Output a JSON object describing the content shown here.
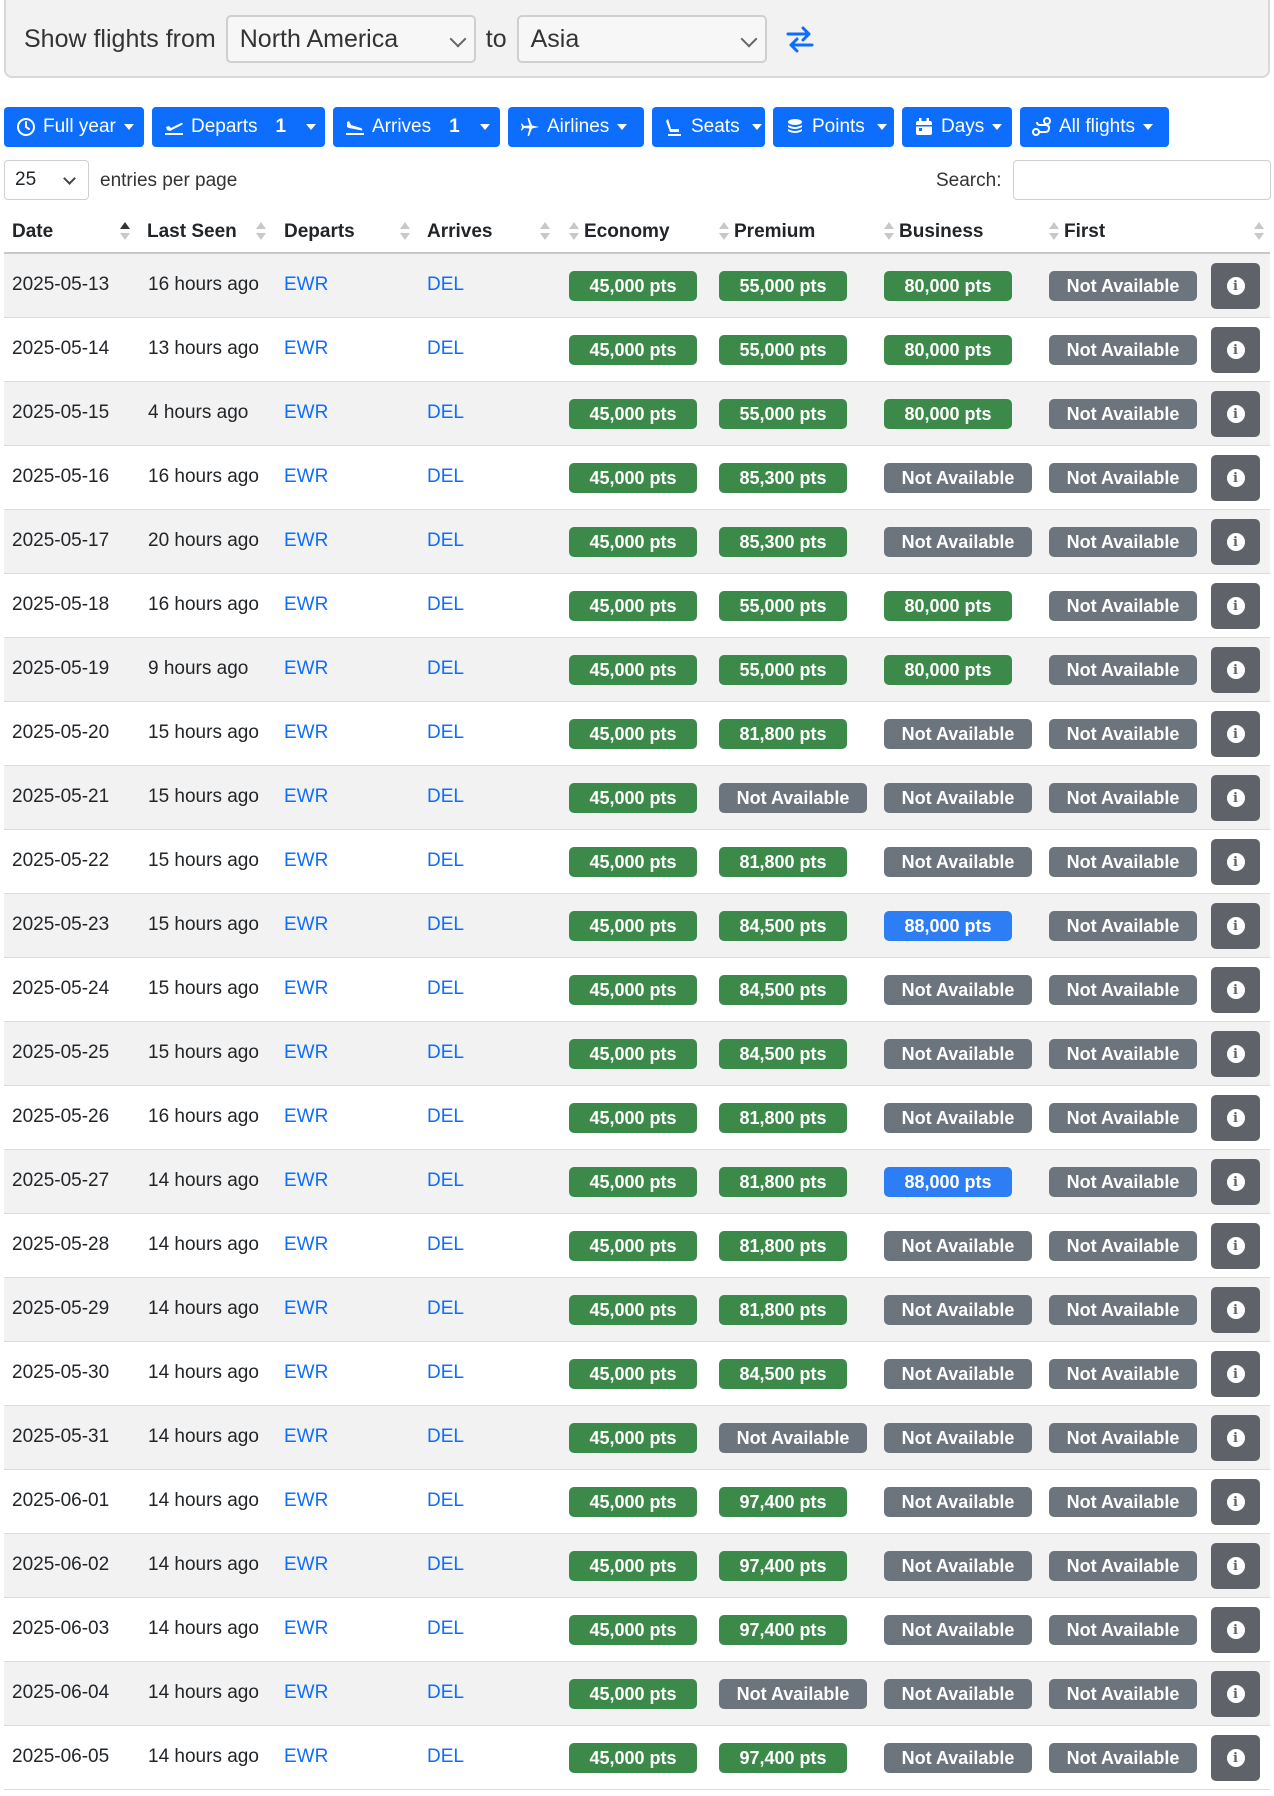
{
  "search": {
    "label_from": "Show flights from",
    "from_value": "North America",
    "label_to": "to",
    "to_value": "Asia"
  },
  "filters": {
    "full_year": "Full year",
    "departs": "Departs",
    "departs_count": "1",
    "arrives": "Arrives",
    "arrives_count": "1",
    "airlines": "Airlines",
    "seats": "Seats",
    "points": "Points",
    "days": "Days",
    "all_flights": "All flights"
  },
  "table_controls": {
    "entries_value": "25",
    "entries_label": "entries per page",
    "search_label": "Search:"
  },
  "columns": [
    "Date",
    "Last Seen",
    "Departs",
    "Arrives",
    "Economy",
    "Premium",
    "Business",
    "First"
  ],
  "rows": [
    {
      "date": "2025-05-13",
      "seen": "16 hours ago",
      "dep": "EWR",
      "arr": "DEL",
      "eco": "45,000 pts",
      "prem": "55,000 pts",
      "bus": "80,000 pts",
      "first": "Not Available"
    },
    {
      "date": "2025-05-14",
      "seen": "13 hours ago",
      "dep": "EWR",
      "arr": "DEL",
      "eco": "45,000 pts",
      "prem": "55,000 pts",
      "bus": "80,000 pts",
      "first": "Not Available"
    },
    {
      "date": "2025-05-15",
      "seen": "4 hours ago",
      "dep": "EWR",
      "arr": "DEL",
      "eco": "45,000 pts",
      "prem": "55,000 pts",
      "bus": "80,000 pts",
      "first": "Not Available"
    },
    {
      "date": "2025-05-16",
      "seen": "16 hours ago",
      "dep": "EWR",
      "arr": "DEL",
      "eco": "45,000 pts",
      "prem": "85,300 pts",
      "bus": "Not Available",
      "first": "Not Available"
    },
    {
      "date": "2025-05-17",
      "seen": "20 hours ago",
      "dep": "EWR",
      "arr": "DEL",
      "eco": "45,000 pts",
      "prem": "85,300 pts",
      "bus": "Not Available",
      "first": "Not Available"
    },
    {
      "date": "2025-05-18",
      "seen": "16 hours ago",
      "dep": "EWR",
      "arr": "DEL",
      "eco": "45,000 pts",
      "prem": "55,000 pts",
      "bus": "80,000 pts",
      "first": "Not Available"
    },
    {
      "date": "2025-05-19",
      "seen": "9 hours ago",
      "dep": "EWR",
      "arr": "DEL",
      "eco": "45,000 pts",
      "prem": "55,000 pts",
      "bus": "80,000 pts",
      "first": "Not Available"
    },
    {
      "date": "2025-05-20",
      "seen": "15 hours ago",
      "dep": "EWR",
      "arr": "DEL",
      "eco": "45,000 pts",
      "prem": "81,800 pts",
      "bus": "Not Available",
      "first": "Not Available"
    },
    {
      "date": "2025-05-21",
      "seen": "15 hours ago",
      "dep": "EWR",
      "arr": "DEL",
      "eco": "45,000 pts",
      "prem": "Not Available",
      "bus": "Not Available",
      "first": "Not Available"
    },
    {
      "date": "2025-05-22",
      "seen": "15 hours ago",
      "dep": "EWR",
      "arr": "DEL",
      "eco": "45,000 pts",
      "prem": "81,800 pts",
      "bus": "Not Available",
      "first": "Not Available"
    },
    {
      "date": "2025-05-23",
      "seen": "15 hours ago",
      "dep": "EWR",
      "arr": "DEL",
      "eco": "45,000 pts",
      "prem": "84,500 pts",
      "bus": "88,000 pts",
      "bus_blue": true,
      "first": "Not Available"
    },
    {
      "date": "2025-05-24",
      "seen": "15 hours ago",
      "dep": "EWR",
      "arr": "DEL",
      "eco": "45,000 pts",
      "prem": "84,500 pts",
      "bus": "Not Available",
      "first": "Not Available"
    },
    {
      "date": "2025-05-25",
      "seen": "15 hours ago",
      "dep": "EWR",
      "arr": "DEL",
      "eco": "45,000 pts",
      "prem": "84,500 pts",
      "bus": "Not Available",
      "first": "Not Available"
    },
    {
      "date": "2025-05-26",
      "seen": "16 hours ago",
      "dep": "EWR",
      "arr": "DEL",
      "eco": "45,000 pts",
      "prem": "81,800 pts",
      "bus": "Not Available",
      "first": "Not Available"
    },
    {
      "date": "2025-05-27",
      "seen": "14 hours ago",
      "dep": "EWR",
      "arr": "DEL",
      "eco": "45,000 pts",
      "prem": "81,800 pts",
      "bus": "88,000 pts",
      "bus_blue": true,
      "first": "Not Available"
    },
    {
      "date": "2025-05-28",
      "seen": "14 hours ago",
      "dep": "EWR",
      "arr": "DEL",
      "eco": "45,000 pts",
      "prem": "81,800 pts",
      "bus": "Not Available",
      "first": "Not Available"
    },
    {
      "date": "2025-05-29",
      "seen": "14 hours ago",
      "dep": "EWR",
      "arr": "DEL",
      "eco": "45,000 pts",
      "prem": "81,800 pts",
      "bus": "Not Available",
      "first": "Not Available"
    },
    {
      "date": "2025-05-30",
      "seen": "14 hours ago",
      "dep": "EWR",
      "arr": "DEL",
      "eco": "45,000 pts",
      "prem": "84,500 pts",
      "bus": "Not Available",
      "first": "Not Available"
    },
    {
      "date": "2025-05-31",
      "seen": "14 hours ago",
      "dep": "EWR",
      "arr": "DEL",
      "eco": "45,000 pts",
      "prem": "Not Available",
      "bus": "Not Available",
      "first": "Not Available"
    },
    {
      "date": "2025-06-01",
      "seen": "14 hours ago",
      "dep": "EWR",
      "arr": "DEL",
      "eco": "45,000 pts",
      "prem": "97,400 pts",
      "bus": "Not Available",
      "first": "Not Available"
    },
    {
      "date": "2025-06-02",
      "seen": "14 hours ago",
      "dep": "EWR",
      "arr": "DEL",
      "eco": "45,000 pts",
      "prem": "97,400 pts",
      "bus": "Not Available",
      "first": "Not Available"
    },
    {
      "date": "2025-06-03",
      "seen": "14 hours ago",
      "dep": "EWR",
      "arr": "DEL",
      "eco": "45,000 pts",
      "prem": "97,400 pts",
      "bus": "Not Available",
      "first": "Not Available"
    },
    {
      "date": "2025-06-04",
      "seen": "14 hours ago",
      "dep": "EWR",
      "arr": "DEL",
      "eco": "45,000 pts",
      "prem": "Not Available",
      "bus": "Not Available",
      "first": "Not Available"
    },
    {
      "date": "2025-06-05",
      "seen": "14 hours ago",
      "dep": "EWR",
      "arr": "DEL",
      "eco": "45,000 pts",
      "prem": "97,400 pts",
      "bus": "Not Available",
      "first": "Not Available"
    }
  ],
  "colors": {
    "primary": "#0d6efd",
    "available": "#3b8a4a",
    "not_available": "#6c757d",
    "highlight": "#2d7df5"
  }
}
